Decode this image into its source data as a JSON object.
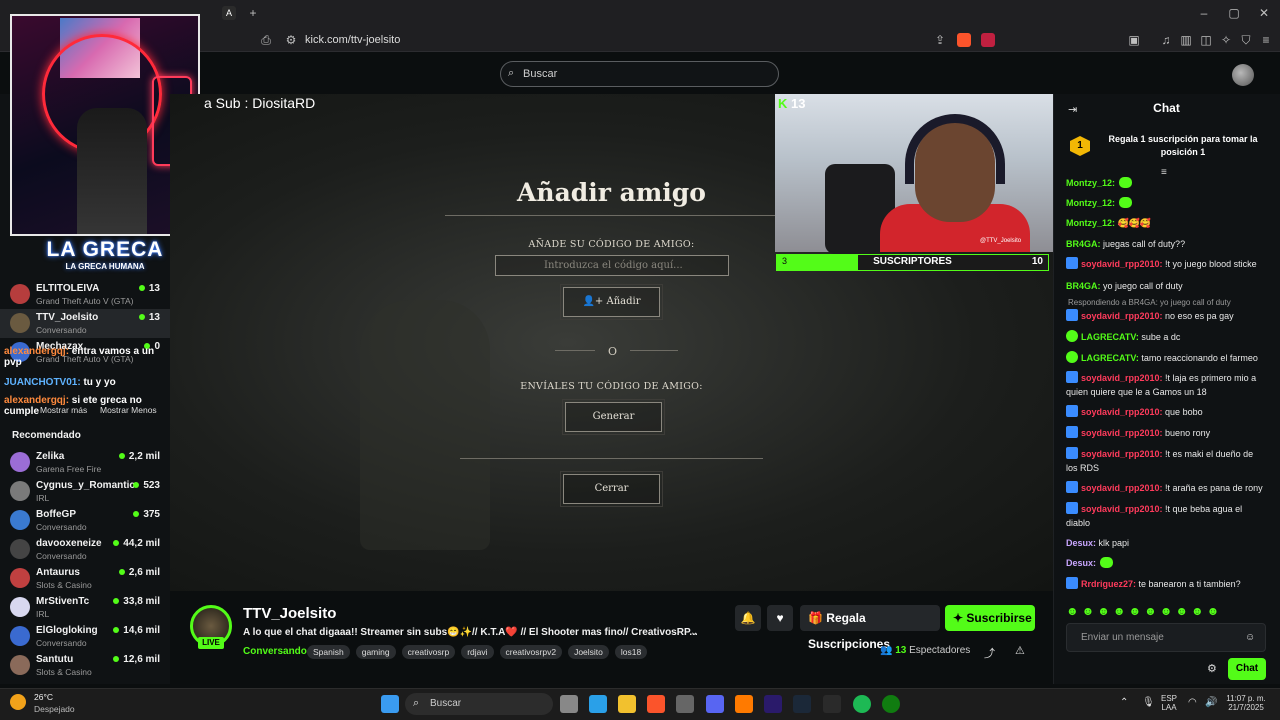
{
  "browser": {
    "url": "kick.com/ttv-joelsito"
  },
  "header": {
    "search_placeholder": "Buscar"
  },
  "sidebar": {
    "logo_title": "LA GRECA",
    "logo_subtitle": "LA GRECA HUMANA",
    "following": [
      {
        "name": "ELTITOLEIVA",
        "category": "Grand Theft Auto V (GTA)",
        "viewers": "13",
        "color": "#b63d3d"
      },
      {
        "name": "TTV_Joelsito",
        "category": "Conversando",
        "viewers": "13",
        "color": "#6a5a40"
      },
      {
        "name": "Mechazax",
        "category": "Grand Theft Auto V (GTA)",
        "viewers": "0",
        "color": "#3a6ad0"
      }
    ],
    "overlay_messages": [
      {
        "user": "alexandergqj:",
        "text": " entra vamos a un pvp"
      },
      {
        "user": "JUANCHOTV01:",
        "text": " tu y yo"
      },
      {
        "user": "alexandergqj:",
        "text": " si ete greca no cumple"
      }
    ],
    "show_more": "Mostrar más",
    "show_less": "Mostrar Menos",
    "recommended_label": "Recomendado",
    "recommended": [
      {
        "name": "Zelika",
        "category": "Garena Free Fire",
        "viewers": "2,2 mil",
        "color": "#9b6dd6"
      },
      {
        "name": "Cygnus_y_Romantic",
        "category": "IRL",
        "viewers": "523",
        "color": "#7a7a7a"
      },
      {
        "name": "BoffeGP",
        "category": "Conversando",
        "viewers": "375",
        "color": "#3a7ad0"
      },
      {
        "name": "davooxeneize",
        "category": "Conversando",
        "viewers": "44,2 mil",
        "color": "#444"
      },
      {
        "name": "Antaurus",
        "category": "Slots & Casino",
        "viewers": "2,6 mil",
        "color": "#c04040"
      },
      {
        "name": "MrStivenTc",
        "category": "IRL",
        "viewers": "33,8 mil",
        "color": "#d8d8f0"
      },
      {
        "name": "ElGlogloking",
        "category": "Conversando",
        "viewers": "14,6 mil",
        "color": "#3a6ad0"
      },
      {
        "name": "Santutu",
        "category": "Slots & Casino",
        "viewers": "12,6 mil",
        "color": "#8a6a5a"
      }
    ]
  },
  "stream": {
    "overlay_text": "a Sub : DiositaRD",
    "kick_viewers": "13",
    "modal": {
      "title": "Añadir amigo",
      "code_label": "AÑADE SU CÓDIGO DE AMIGO:",
      "input_placeholder": "Introduzca el código aquí...",
      "add_button": "Añadir",
      "or": "O",
      "send_label": "ENVÍALES TU CÓDIGO DE AMIGO:",
      "generate_button": "Generar",
      "close_button": "Cerrar"
    },
    "tiktok_handle": "@TTV_Joelsito",
    "sub_goal": {
      "label": "SUSCRIPTORES",
      "current": "3",
      "target": "10",
      "progress": 0.3
    }
  },
  "info": {
    "channel_name": "TTV_Joelsito",
    "live_label": "LIVE",
    "title": "A lo que el chat digaaa!! Streamer sin subs😁✨// K.T.A❤️ // El Shooter mas fino// CreativosRP...",
    "category": "Conversando",
    "tags": [
      "Spanish",
      "gaming",
      "creativosrp",
      "rdjavi",
      "creativosrpv2",
      "Joelsito",
      "los18"
    ],
    "gift_button": "Regala Suscripciones",
    "subscribe_button": "Suscribirse",
    "viewers_count": "13",
    "viewers_label": "Espectadores"
  },
  "chat": {
    "title": "Chat",
    "pinned_rank": "1",
    "pinned_text": "Regala 1 suscripción para tomar la posición 1",
    "messages": [
      {
        "user": "Montzy_12:",
        "text": "",
        "style": "g",
        "badge": "none",
        "emotes": 1
      },
      {
        "user": "Montzy_12:",
        "text": "",
        "style": "g",
        "badge": "none",
        "emotes": 1
      },
      {
        "user": "Montzy_12:",
        "text": " 🥰🥰🥰",
        "style": "g",
        "badge": "none",
        "emotes": 0
      },
      {
        "user": "BR4GA:",
        "text": " juegas call of duty??",
        "style": "g",
        "badge": "none",
        "emotes": 0
      },
      {
        "user": "soydavid_rpp2010:",
        "text": " !t yo juego blood sticke",
        "style": "r",
        "badge": "blue",
        "emotes": 0
      },
      {
        "user": "BR4GA:",
        "text": " yo juego call of duty",
        "style": "g",
        "badge": "none",
        "emotes": 0
      },
      {
        "user": "soydavid_rpp2010:",
        "text": " no eso es pa gay",
        "style": "r",
        "badge": "blue",
        "emotes": 0,
        "reply": "Respondiendo a BR4GA: yo juego call of duty"
      },
      {
        "user": "LAGRECATV:",
        "text": " sube a dc",
        "style": "g",
        "badge": "green",
        "emotes": 0
      },
      {
        "user": "LAGRECATV:",
        "text": " tamo reaccionando el farmeo",
        "style": "g",
        "badge": "green",
        "emotes": 0
      },
      {
        "user": "soydavid_rpp2010:",
        "text": " !t laja es primero mio a quien quiere que le a Gamos un 18",
        "style": "r",
        "badge": "blue",
        "emotes": 0
      },
      {
        "user": "soydavid_rpp2010:",
        "text": " que bobo",
        "style": "r",
        "badge": "blue",
        "emotes": 0
      },
      {
        "user": "soydavid_rpp2010:",
        "text": " bueno rony",
        "style": "r",
        "badge": "blue",
        "emotes": 0
      },
      {
        "user": "soydavid_rpp2010:",
        "text": " !t es maki el dueño de los RDS",
        "style": "r",
        "badge": "blue",
        "emotes": 0
      },
      {
        "user": "soydavid_rpp2010:",
        "text": " !t araña es pana de rony",
        "style": "r",
        "badge": "blue",
        "emotes": 0
      },
      {
        "user": "soydavid_rpp2010:",
        "text": " !t que beba agua el diablo",
        "style": "r",
        "badge": "blue",
        "emotes": 0
      },
      {
        "user": "Desux:",
        "text": " klk papi",
        "style": "p",
        "badge": "none",
        "emotes": 0
      },
      {
        "user": "Desux:",
        "text": "",
        "style": "p",
        "badge": "none",
        "emotes": 1
      },
      {
        "user": "Rrdriguez27:",
        "text": " te banearon a ti tambien?",
        "style": "r",
        "badge": "blue",
        "emotes": 0
      }
    ],
    "input_placeholder": "Enviar un mensaje",
    "send_button": "Chat"
  },
  "taskbar": {
    "weather_temp": "26°C",
    "weather_desc": "Despejado",
    "search_label": "Buscar",
    "lang": "ESP",
    "lang_sub": "LAA",
    "time": "11:07 p. m.",
    "date": "21/7/2025"
  },
  "colors": {
    "accent": "#53fc18",
    "bg": "#0b0e0f"
  }
}
